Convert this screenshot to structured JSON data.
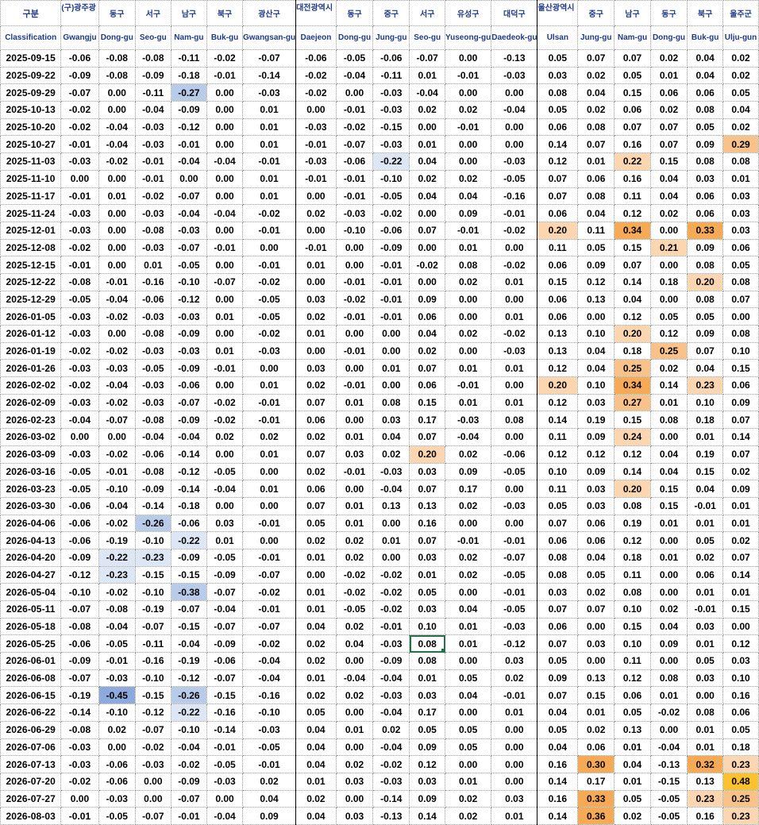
{
  "header": {
    "classification_ko": "구분",
    "classification_en": "Classification",
    "districts_ko": [
      "(구)광주광",
      "동구",
      "서구",
      "남구",
      "북구",
      "광산구",
      "대전광역시",
      "동구",
      "중구",
      "서구",
      "유성구",
      "대덕구",
      "울산광역시",
      "중구",
      "남구",
      "동구",
      "북구",
      "울주군"
    ],
    "districts_en": [
      "Gwangju",
      "Dong-gu",
      "Seo-gu",
      "Nam-gu",
      "Buk-gu",
      "Gwangsan-gu",
      "Daejeon",
      "Dong-gu",
      "Jung-gu",
      "Seo-gu",
      "Yuseong-gu",
      "Daedeok-gu",
      "Ulsan",
      "Jung-gu",
      "Nam-gu",
      "Dong-gu",
      "Buk-gu",
      "Ulju-gun"
    ]
  },
  "colors": {
    "header_text": "#1f3a86",
    "negative_light": "#dce6f4",
    "negative_mid": "#b8cbe9",
    "negative_strong": "#8eaadc",
    "positive_light": "#fbd6b1",
    "positive_mid": "#f9c28a",
    "positive_strong": "#f7aa55",
    "positive_max": "#f9c22e",
    "selection": "#217346"
  },
  "rows": [
    {
      "date": "2025-09-15",
      "v": [
        "-0.06",
        "-0.08",
        "-0.08",
        "-0.11",
        "-0.02",
        "-0.07",
        "-0.06",
        "-0.05",
        "-0.06",
        "-0.07",
        "0.00",
        "-0.13",
        "0.05",
        "0.07",
        "0.07",
        "0.02",
        "0.04",
        "0.02"
      ]
    },
    {
      "date": "2025-09-22",
      "v": [
        "-0.09",
        "-0.08",
        "-0.09",
        "-0.18",
        "-0.01",
        "-0.14",
        "-0.02",
        "-0.04",
        "-0.11",
        "0.01",
        "-0.01",
        "-0.03",
        "0.03",
        "0.02",
        "0.05",
        "0.01",
        "0.04",
        "0.02"
      ]
    },
    {
      "date": "2025-09-29",
      "v": [
        "-0.07",
        "0.00",
        "-0.11",
        "-0.27",
        "0.00",
        "-0.03",
        "-0.02",
        "0.00",
        "-0.03",
        "-0.04",
        "0.00",
        "0.00",
        "0.08",
        "0.04",
        "0.15",
        "0.06",
        "0.06",
        "0.05"
      ]
    },
    {
      "date": "2025-10-13",
      "v": [
        "-0.02",
        "0.00",
        "-0.04",
        "-0.09",
        "0.00",
        "0.01",
        "0.00",
        "-0.01",
        "-0.03",
        "0.02",
        "0.02",
        "-0.04",
        "0.05",
        "0.02",
        "0.06",
        "0.02",
        "0.08",
        "0.04"
      ]
    },
    {
      "date": "2025-10-20",
      "v": [
        "-0.02",
        "-0.04",
        "-0.03",
        "-0.12",
        "0.00",
        "0.01",
        "-0.03",
        "-0.02",
        "-0.15",
        "0.00",
        "-0.01",
        "0.00",
        "0.06",
        "0.08",
        "0.07",
        "0.07",
        "0.05",
        "0.02"
      ]
    },
    {
      "date": "2025-10-27",
      "v": [
        "-0.01",
        "-0.04",
        "-0.03",
        "-0.01",
        "0.00",
        "0.01",
        "-0.01",
        "-0.07",
        "-0.03",
        "0.01",
        "0.00",
        "0.00",
        "0.14",
        "0.07",
        "0.16",
        "0.07",
        "0.09",
        "0.29"
      ]
    },
    {
      "date": "2025-11-03",
      "v": [
        "-0.03",
        "-0.02",
        "-0.01",
        "-0.04",
        "-0.04",
        "-0.01",
        "-0.03",
        "-0.06",
        "-0.22",
        "0.04",
        "0.00",
        "-0.03",
        "0.12",
        "0.01",
        "0.22",
        "0.15",
        "0.08",
        "0.08"
      ]
    },
    {
      "date": "2025-11-10",
      "v": [
        "0.00",
        "0.00",
        "-0.01",
        "0.00",
        "0.00",
        "0.01",
        "-0.01",
        "-0.01",
        "-0.10",
        "0.02",
        "0.02",
        "-0.05",
        "0.07",
        "0.06",
        "0.16",
        "0.04",
        "0.03",
        "0.01"
      ]
    },
    {
      "date": "2025-11-17",
      "v": [
        "-0.01",
        "0.01",
        "-0.02",
        "-0.07",
        "0.00",
        "0.01",
        "0.00",
        "-0.01",
        "-0.05",
        "0.04",
        "0.04",
        "-0.16",
        "0.07",
        "0.08",
        "0.11",
        "0.04",
        "0.06",
        "0.03"
      ]
    },
    {
      "date": "2025-11-24",
      "v": [
        "-0.03",
        "0.00",
        "-0.03",
        "-0.04",
        "-0.04",
        "-0.02",
        "0.02",
        "-0.03",
        "-0.02",
        "0.00",
        "0.09",
        "-0.01",
        "0.06",
        "0.04",
        "0.12",
        "0.02",
        "0.06",
        "0.03"
      ]
    },
    {
      "date": "2025-12-01",
      "v": [
        "-0.03",
        "0.00",
        "-0.08",
        "-0.03",
        "0.00",
        "-0.01",
        "0.00",
        "-0.10",
        "-0.06",
        "0.07",
        "-0.01",
        "-0.02",
        "0.20",
        "0.11",
        "0.34",
        "0.00",
        "0.33",
        "0.03"
      ]
    },
    {
      "date": "2025-12-08",
      "v": [
        "-0.02",
        "0.00",
        "-0.03",
        "-0.07",
        "-0.01",
        "0.00",
        "-0.01",
        "0.00",
        "-0.09",
        "0.00",
        "0.01",
        "0.00",
        "0.11",
        "0.05",
        "0.15",
        "0.21",
        "0.09",
        "0.06"
      ]
    },
    {
      "date": "2025-12-15",
      "v": [
        "-0.01",
        "0.00",
        "0.01",
        "-0.05",
        "0.00",
        "-0.01",
        "0.01",
        "0.00",
        "-0.01",
        "-0.02",
        "0.08",
        "-0.02",
        "0.06",
        "0.09",
        "0.07",
        "0.00",
        "0.08",
        "0.05"
      ]
    },
    {
      "date": "2025-12-22",
      "v": [
        "-0.08",
        "-0.01",
        "-0.16",
        "-0.10",
        "-0.07",
        "-0.02",
        "0.00",
        "-0.01",
        "-0.01",
        "0.00",
        "0.02",
        "0.01",
        "0.15",
        "0.12",
        "0.14",
        "0.18",
        "0.20",
        "0.08"
      ]
    },
    {
      "date": "2025-12-29",
      "v": [
        "-0.05",
        "-0.04",
        "-0.06",
        "-0.12",
        "0.00",
        "-0.05",
        "0.03",
        "-0.02",
        "-0.01",
        "0.09",
        "0.00",
        "0.00",
        "0.06",
        "0.13",
        "0.04",
        "0.00",
        "0.08",
        "0.07"
      ]
    },
    {
      "date": "2026-01-05",
      "v": [
        "-0.03",
        "-0.02",
        "-0.03",
        "-0.03",
        "0.01",
        "-0.05",
        "0.02",
        "-0.01",
        "-0.01",
        "0.06",
        "0.00",
        "0.01",
        "0.06",
        "0.00",
        "0.12",
        "0.05",
        "0.05",
        "0.00"
      ]
    },
    {
      "date": "2026-01-12",
      "v": [
        "-0.03",
        "0.00",
        "-0.08",
        "-0.09",
        "0.00",
        "-0.02",
        "0.01",
        "0.00",
        "0.00",
        "0.04",
        "0.02",
        "-0.02",
        "0.13",
        "0.10",
        "0.20",
        "0.12",
        "0.09",
        "0.08"
      ]
    },
    {
      "date": "2026-01-19",
      "v": [
        "-0.02",
        "-0.02",
        "-0.03",
        "-0.03",
        "0.01",
        "-0.03",
        "0.00",
        "-0.01",
        "0.00",
        "0.02",
        "0.00",
        "-0.03",
        "0.13",
        "0.04",
        "0.18",
        "0.25",
        "0.07",
        "0.10"
      ]
    },
    {
      "date": "2026-01-26",
      "v": [
        "-0.03",
        "-0.03",
        "-0.05",
        "-0.09",
        "-0.01",
        "0.00",
        "0.03",
        "0.00",
        "0.01",
        "0.07",
        "0.01",
        "0.01",
        "0.12",
        "0.04",
        "0.25",
        "0.02",
        "0.04",
        "0.15"
      ]
    },
    {
      "date": "2026-02-02",
      "v": [
        "-0.02",
        "-0.04",
        "-0.03",
        "-0.06",
        "0.00",
        "0.01",
        "0.02",
        "-0.01",
        "0.00",
        "0.06",
        "-0.01",
        "0.00",
        "0.20",
        "0.10",
        "0.34",
        "0.14",
        "0.23",
        "0.06"
      ]
    },
    {
      "date": "2026-02-09",
      "v": [
        "-0.03",
        "-0.02",
        "-0.03",
        "-0.07",
        "-0.02",
        "-0.01",
        "0.07",
        "0.01",
        "0.08",
        "0.15",
        "0.01",
        "0.01",
        "0.12",
        "0.03",
        "0.27",
        "0.01",
        "0.10",
        "0.09"
      ]
    },
    {
      "date": "2026-02-23",
      "v": [
        "-0.04",
        "-0.07",
        "-0.08",
        "-0.09",
        "-0.02",
        "-0.01",
        "0.06",
        "0.00",
        "0.03",
        "0.17",
        "-0.03",
        "0.08",
        "0.14",
        "0.19",
        "0.15",
        "0.08",
        "0.18",
        "0.07"
      ]
    },
    {
      "date": "2026-03-02",
      "v": [
        "0.00",
        "0.00",
        "-0.04",
        "-0.04",
        "0.02",
        "0.02",
        "0.02",
        "0.01",
        "0.04",
        "0.07",
        "-0.04",
        "0.00",
        "0.11",
        "0.09",
        "0.24",
        "0.00",
        "0.01",
        "0.14"
      ]
    },
    {
      "date": "2026-03-09",
      "v": [
        "-0.03",
        "-0.02",
        "-0.06",
        "-0.14",
        "0.00",
        "0.01",
        "0.07",
        "0.03",
        "0.02",
        "0.20",
        "0.02",
        "-0.06",
        "0.12",
        "0.12",
        "0.12",
        "0.04",
        "0.19",
        "0.07"
      ]
    },
    {
      "date": "2026-03-16",
      "v": [
        "-0.05",
        "-0.01",
        "-0.08",
        "-0.12",
        "-0.05",
        "0.00",
        "0.02",
        "-0.01",
        "-0.03",
        "0.03",
        "0.09",
        "-0.05",
        "0.10",
        "0.09",
        "0.14",
        "0.04",
        "0.15",
        "0.02"
      ]
    },
    {
      "date": "2026-03-23",
      "v": [
        "-0.05",
        "-0.10",
        "-0.09",
        "-0.14",
        "-0.04",
        "0.01",
        "0.06",
        "0.00",
        "-0.04",
        "0.07",
        "0.17",
        "0.00",
        "0.11",
        "0.03",
        "0.20",
        "0.15",
        "0.04",
        "0.09"
      ]
    },
    {
      "date": "2026-03-30",
      "v": [
        "-0.06",
        "-0.04",
        "-0.14",
        "-0.18",
        "0.00",
        "0.00",
        "0.07",
        "0.01",
        "0.13",
        "0.13",
        "0.02",
        "-0.03",
        "0.05",
        "0.03",
        "0.08",
        "0.15",
        "-0.01",
        "0.01"
      ]
    },
    {
      "date": "2026-04-06",
      "v": [
        "-0.06",
        "-0.02",
        "-0.26",
        "-0.06",
        "0.03",
        "-0.01",
        "0.05",
        "0.01",
        "0.00",
        "0.16",
        "0.00",
        "0.00",
        "0.07",
        "0.06",
        "0.19",
        "0.01",
        "0.01",
        "0.01"
      ]
    },
    {
      "date": "2026-04-13",
      "v": [
        "-0.06",
        "-0.19",
        "-0.10",
        "-0.22",
        "0.01",
        "0.00",
        "0.02",
        "0.02",
        "0.01",
        "0.07",
        "-0.01",
        "-0.01",
        "0.06",
        "0.06",
        "0.12",
        "0.00",
        "0.05",
        "0.02"
      ]
    },
    {
      "date": "2026-04-20",
      "v": [
        "-0.09",
        "-0.22",
        "-0.23",
        "-0.09",
        "-0.05",
        "-0.01",
        "0.01",
        "0.02",
        "0.00",
        "0.03",
        "0.02",
        "-0.07",
        "0.08",
        "0.04",
        "0.18",
        "0.01",
        "0.02",
        "0.07"
      ]
    },
    {
      "date": "2026-04-27",
      "v": [
        "-0.12",
        "-0.23",
        "-0.15",
        "-0.15",
        "-0.09",
        "-0.07",
        "0.00",
        "-0.02",
        "-0.02",
        "0.01",
        "0.02",
        "-0.05",
        "0.08",
        "0.05",
        "0.11",
        "0.00",
        "0.06",
        "0.14"
      ]
    },
    {
      "date": "2026-05-04",
      "v": [
        "-0.10",
        "-0.02",
        "-0.10",
        "-0.38",
        "-0.07",
        "-0.02",
        "0.01",
        "-0.02",
        "-0.02",
        "0.05",
        "0.00",
        "-0.01",
        "0.03",
        "0.02",
        "0.08",
        "0.00",
        "0.01",
        "0.01"
      ]
    },
    {
      "date": "2026-05-11",
      "v": [
        "-0.07",
        "-0.08",
        "-0.19",
        "-0.07",
        "-0.04",
        "-0.01",
        "0.01",
        "-0.05",
        "-0.02",
        "0.03",
        "0.04",
        "-0.05",
        "0.07",
        "0.07",
        "0.10",
        "0.02",
        "-0.01",
        "0.15"
      ]
    },
    {
      "date": "2026-05-18",
      "v": [
        "-0.08",
        "-0.04",
        "-0.07",
        "-0.15",
        "-0.07",
        "-0.07",
        "0.04",
        "0.02",
        "-0.01",
        "0.10",
        "0.01",
        "-0.03",
        "0.06",
        "0.00",
        "0.15",
        "0.04",
        "0.03",
        "0.00"
      ]
    },
    {
      "date": "2026-05-25",
      "v": [
        "-0.06",
        "-0.05",
        "-0.11",
        "-0.04",
        "-0.09",
        "-0.02",
        "0.02",
        "0.04",
        "-0.03",
        "0.08",
        "0.01",
        "-0.12",
        "0.07",
        "0.03",
        "0.10",
        "0.09",
        "0.01",
        "0.12"
      ]
    },
    {
      "date": "2026-06-01",
      "v": [
        "-0.09",
        "-0.01",
        "-0.16",
        "-0.19",
        "-0.06",
        "-0.04",
        "0.02",
        "0.00",
        "-0.09",
        "0.08",
        "0.00",
        "0.03",
        "0.05",
        "0.00",
        "0.11",
        "0.00",
        "0.05",
        "0.03"
      ]
    },
    {
      "date": "2026-06-08",
      "v": [
        "-0.07",
        "-0.03",
        "-0.10",
        "-0.12",
        "-0.07",
        "-0.04",
        "0.01",
        "-0.04",
        "-0.04",
        "0.01",
        "0.05",
        "0.02",
        "0.09",
        "0.13",
        "0.12",
        "0.08",
        "0.03",
        "0.10"
      ]
    },
    {
      "date": "2026-06-15",
      "v": [
        "-0.19",
        "-0.45",
        "-0.15",
        "-0.26",
        "-0.15",
        "-0.16",
        "0.02",
        "0.02",
        "-0.03",
        "0.03",
        "0.04",
        "-0.01",
        "0.07",
        "0.15",
        "0.06",
        "0.01",
        "0.00",
        "0.16"
      ]
    },
    {
      "date": "2026-06-22",
      "v": [
        "-0.14",
        "-0.10",
        "-0.12",
        "-0.22",
        "-0.16",
        "-0.10",
        "0.05",
        "0.00",
        "-0.04",
        "0.17",
        "0.00",
        "0.01",
        "0.04",
        "0.01",
        "0.05",
        "-0.02",
        "0.08",
        "0.06"
      ]
    },
    {
      "date": "2026-06-29",
      "v": [
        "-0.08",
        "0.02",
        "-0.07",
        "-0.10",
        "-0.14",
        "-0.03",
        "0.04",
        "0.01",
        "0.02",
        "0.05",
        "0.05",
        "0.00",
        "0.05",
        "0.02",
        "0.13",
        "0.00",
        "0.01",
        "0.05"
      ]
    },
    {
      "date": "2026-07-06",
      "v": [
        "-0.03",
        "0.00",
        "-0.02",
        "-0.04",
        "-0.01",
        "-0.05",
        "0.04",
        "0.00",
        "-0.04",
        "0.09",
        "0.05",
        "0.00",
        "0.04",
        "0.06",
        "0.01",
        "-0.04",
        "0.01",
        "0.18"
      ]
    },
    {
      "date": "2026-07-13",
      "v": [
        "-0.03",
        "-0.06",
        "-0.03",
        "-0.02",
        "-0.05",
        "-0.01",
        "0.04",
        "0.02",
        "-0.02",
        "0.12",
        "0.00",
        "0.00",
        "0.16",
        "0.30",
        "0.04",
        "-0.13",
        "0.32",
        "0.23"
      ]
    },
    {
      "date": "2026-07-20",
      "v": [
        "-0.02",
        "-0.06",
        "0.00",
        "-0.09",
        "-0.03",
        "0.02",
        "0.01",
        "0.03",
        "-0.03",
        "0.03",
        "0.01",
        "0.00",
        "0.14",
        "0.17",
        "0.01",
        "-0.15",
        "0.13",
        "0.48"
      ]
    },
    {
      "date": "2026-07-27",
      "v": [
        "0.00",
        "-0.03",
        "0.00",
        "-0.07",
        "0.00",
        "0.04",
        "0.02",
        "0.00",
        "-0.14",
        "0.09",
        "0.02",
        "0.03",
        "0.16",
        "0.33",
        "0.05",
        "-0.05",
        "0.23",
        "0.25"
      ]
    },
    {
      "date": "2026-08-03",
      "v": [
        "-0.01",
        "-0.05",
        "-0.07",
        "-0.01",
        "-0.04",
        "0.09",
        "0.04",
        "0.03",
        "-0.13",
        "0.14",
        "0.02",
        "0.01",
        "0.14",
        "0.36",
        "0.02",
        "-0.05",
        "0.16",
        "0.23"
      ]
    }
  ]
}
